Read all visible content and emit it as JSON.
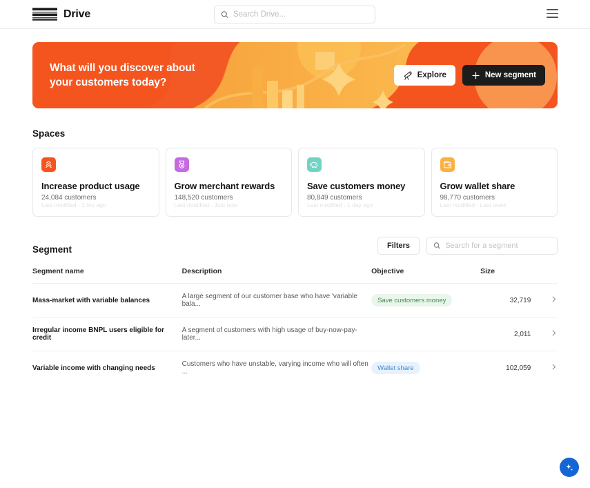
{
  "header": {
    "brand": "Drive",
    "logo_icon": "stack-lines-icon",
    "search": {
      "value": "",
      "placeholder": "Search Drive...",
      "icon": "search-icon"
    },
    "menu_icon": "hamburger-menu-icon"
  },
  "hero": {
    "title_line1": "What will you discover about",
    "title_line2": "your customers today?",
    "bg_color": "#f4551f",
    "accent_color": "#fbbf4d",
    "explore_label": "Explore",
    "explore_icon": "telescope-icon",
    "new_segment_label": "New segment",
    "new_segment_icon": "plus-icon"
  },
  "spaces": {
    "title": "Spaces",
    "cards": [
      {
        "icon": "chevrons-up-icon",
        "icon_bg": "#f4551f",
        "title": "Increase product usage",
        "count": "24,084 customers",
        "modified": "Last modified · 1 hrs ago"
      },
      {
        "icon": "medal-icon",
        "icon_bg": "#c56ae0",
        "title": "Grow merchant rewards",
        "count": "148,520 customers",
        "modified": "Last modified · Just now"
      },
      {
        "icon": "piggy-bank-icon",
        "icon_bg": "#72d3c4",
        "title": "Save customers money",
        "count": "80,849 customers",
        "modified": "Last modified · 1 day ago"
      },
      {
        "icon": "wallet-icon",
        "icon_bg": "#fbb040",
        "title": "Grow wallet share",
        "count": "98,770 customers",
        "modified": "Last modified · Last week"
      }
    ]
  },
  "segment": {
    "title": "Segment",
    "filters_label": "Filters",
    "search": {
      "value": "",
      "placeholder": "Search for a segment",
      "icon": "search-icon"
    },
    "columns": [
      "Segment name",
      "Description",
      "Objective",
      "Size",
      ""
    ],
    "rows": [
      {
        "name": "Mass-market with variable balances",
        "description": "A large segment of our customer base who have 'variable bala...",
        "objective": "Save customers money",
        "objective_style": "green",
        "size": "32,719",
        "arrow_icon": "chevron-right-icon"
      },
      {
        "name": "Irregular income BNPL users eligible for credit",
        "description": "A segment of customers with high usage of buy-now-pay-later...",
        "objective": "",
        "objective_style": "none",
        "size": "2,011",
        "arrow_icon": "chevron-right-icon"
      },
      {
        "name": "Variable income with changing needs",
        "description": "Customers who have unstable, varying income who will often ...",
        "objective": "Wallet share",
        "objective_style": "blue",
        "size": "102,059",
        "arrow_icon": "chevron-right-icon"
      }
    ]
  },
  "fab": {
    "icon": "sparkles-icon",
    "color": "#1466d4"
  }
}
